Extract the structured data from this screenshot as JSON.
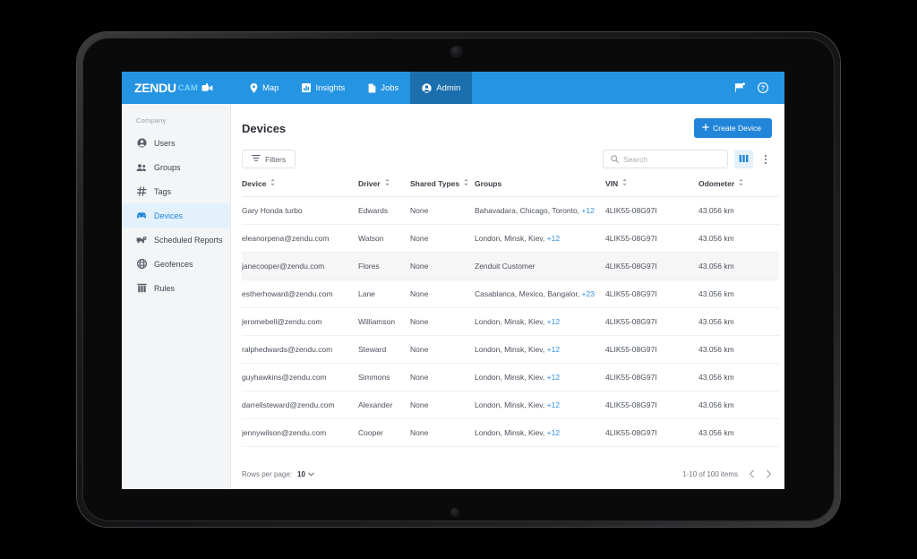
{
  "brand": {
    "logo_primary": "ZENDU",
    "logo_secondary": "CAM",
    "accent_blue": "#2494e3",
    "active_tab_blue": "#1b6fad",
    "link_blue": "#2f90e0"
  },
  "topnav": {
    "tabs": [
      {
        "label": "Map",
        "icon": "map-pin-icon",
        "active": false
      },
      {
        "label": "Insights",
        "icon": "bar-chart-icon",
        "active": false
      },
      {
        "label": "Jobs",
        "icon": "document-icon",
        "active": false
      },
      {
        "label": "Admin",
        "icon": "user-circle-icon",
        "active": true
      }
    ],
    "right_icons": [
      {
        "name": "flag-icon"
      },
      {
        "name": "help-circle-icon"
      }
    ]
  },
  "sidebar": {
    "section_label": "Company",
    "items": [
      {
        "label": "Users",
        "icon": "user-circle-icon",
        "active": false
      },
      {
        "label": "Groups",
        "icon": "people-icon",
        "active": false
      },
      {
        "label": "Tags",
        "icon": "hash-icon",
        "active": false
      },
      {
        "label": "Devices",
        "icon": "car-icon",
        "active": true
      },
      {
        "label": "Scheduled Reports",
        "icon": "truck-clock-icon",
        "active": false
      },
      {
        "label": "Geofences",
        "icon": "globe-icon",
        "active": false
      },
      {
        "label": "Rules",
        "icon": "columns-icon",
        "active": false
      }
    ]
  },
  "main": {
    "title": "Devices",
    "create_button": "Create Device",
    "filters_button": "Filters",
    "search_placeholder": "Search",
    "search_value": ""
  },
  "table": {
    "columns": [
      {
        "label": "Device",
        "sortable": true
      },
      {
        "label": "Driver",
        "sortable": true
      },
      {
        "label": "Shared Types",
        "sortable": true
      },
      {
        "label": "Groups",
        "sortable": false
      },
      {
        "label": "VIN",
        "sortable": true
      },
      {
        "label": "Odometer",
        "sortable": true
      }
    ],
    "rows": [
      {
        "device": "Gary Honda turbo",
        "driver": "Edwards",
        "shared": "None",
        "groups": "Bahavadara, Chicago, Toronto,",
        "groups_more": "+12",
        "vin": "4LIK55-08G97I",
        "odometer": "43.056 km",
        "highlighted": false
      },
      {
        "device": "eleanorpena@zendu.com",
        "driver": "Watson",
        "shared": "None",
        "groups": "London, Minsk, Kiev,",
        "groups_more": "+12",
        "vin": "4LIK55-08G97I",
        "odometer": "43.056 km",
        "highlighted": false
      },
      {
        "device": "janecooper@zendu.com",
        "driver": "Flores",
        "shared": "None",
        "groups": "Zenduit Customer",
        "groups_more": "",
        "vin": "4LIK55-08G97I",
        "odometer": "43.056 km",
        "highlighted": true
      },
      {
        "device": "estherhoward@zendu.com",
        "driver": "Lane",
        "shared": "None",
        "groups": "Casablanca, Mexico, Bangalor,",
        "groups_more": "+23",
        "vin": "4LIK55-08G97I",
        "odometer": "43.056 km",
        "highlighted": false
      },
      {
        "device": "jeromebell@zendu.com",
        "driver": "Williamson",
        "shared": "None",
        "groups": "London, Minsk, Kiev,",
        "groups_more": "+12",
        "vin": "4LIK55-08G97I",
        "odometer": "43.056 km",
        "highlighted": false
      },
      {
        "device": "ralphedwards@zendu.com",
        "driver": "Steward",
        "shared": "None",
        "groups": "London, Minsk, Kiev,",
        "groups_more": "+12",
        "vin": "4LIK55-08G97I",
        "odometer": "43.056 km",
        "highlighted": false
      },
      {
        "device": "guyhawkins@zendu.com",
        "driver": "Simmons",
        "shared": "None",
        "groups": "London, Minsk, Kiev,",
        "groups_more": "+12",
        "vin": "4LIK55-08G97I",
        "odometer": "43.056 km",
        "highlighted": false
      },
      {
        "device": "darrellsteward@zendu.com",
        "driver": "Alexander",
        "shared": "None",
        "groups": "London, Minsk, Kiev,",
        "groups_more": "+12",
        "vin": "4LIK55-08G97I",
        "odometer": "43.056 km",
        "highlighted": false
      },
      {
        "device": "jennywilson@zendu.com",
        "driver": "Cooper",
        "shared": "None",
        "groups": "London, Minsk, Kiev,",
        "groups_more": "+12",
        "vin": "4LIK55-08G97I",
        "odometer": "43.056 km",
        "highlighted": false
      }
    ]
  },
  "footer": {
    "rows_per_page_label": "Rows per page:",
    "rows_per_page_value": "10",
    "range_label": "1-10 of 100 items",
    "prev_icon": "chevron-left-icon",
    "next_icon": "chevron-right-icon"
  }
}
